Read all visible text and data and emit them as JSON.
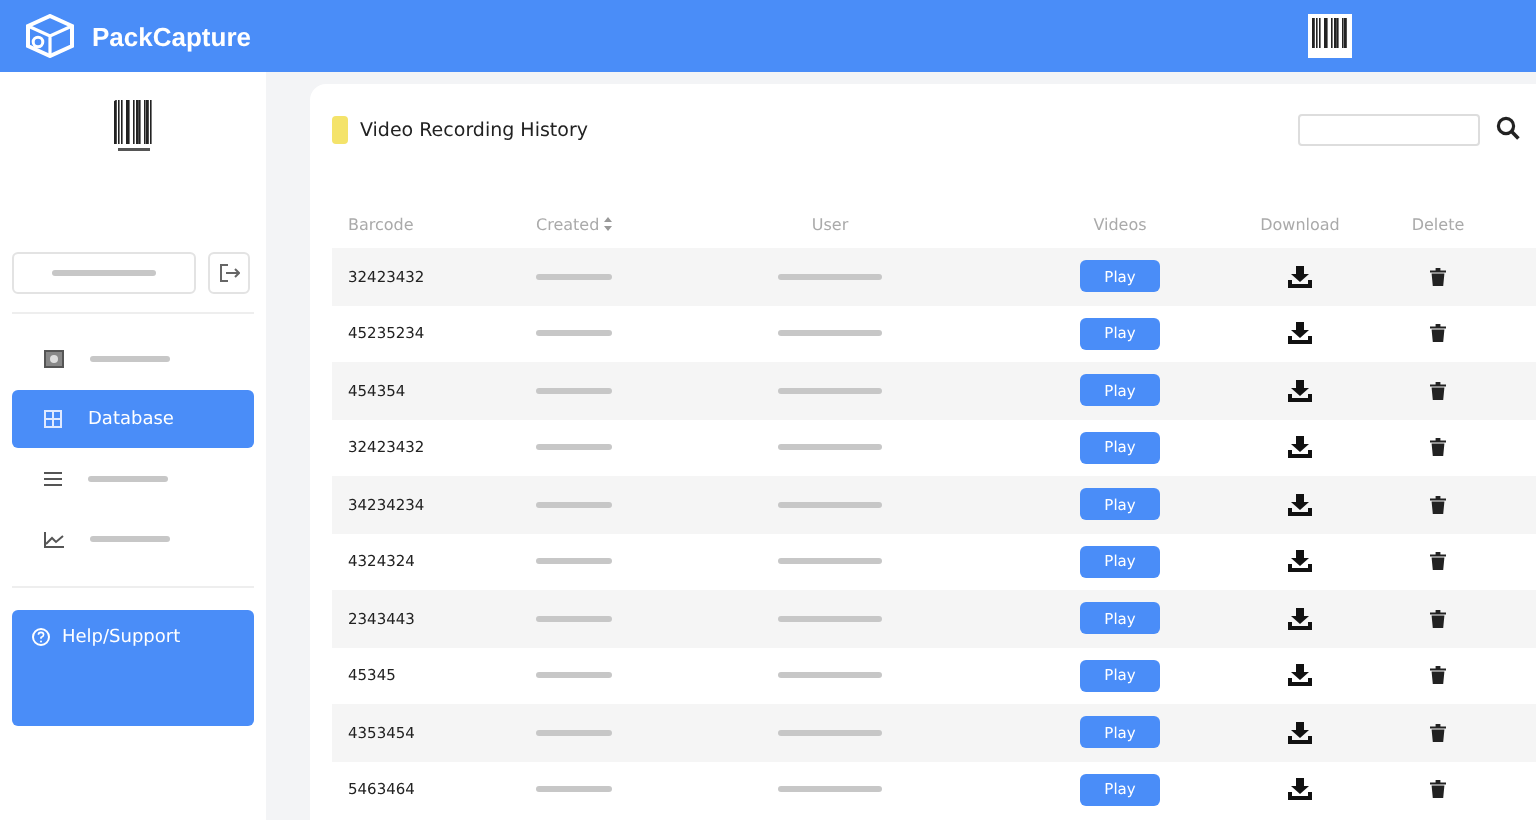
{
  "app": {
    "title": "PackCapture"
  },
  "sidebar": {
    "nav": [
      {
        "kind": "gallery",
        "selected": false
      },
      {
        "kind": "grid",
        "label": "Database",
        "selected": true
      },
      {
        "kind": "list",
        "selected": false
      },
      {
        "kind": "chart",
        "selected": false
      }
    ],
    "help": {
      "label": "Help/Support"
    }
  },
  "panel": {
    "title": "Video Recording History",
    "columns": [
      {
        "label": "Barcode",
        "sortable": false
      },
      {
        "label": "Created",
        "sortable": true
      },
      {
        "label": "User",
        "sortable": false
      },
      {
        "label": "Videos",
        "sortable": false
      },
      {
        "label": "Download",
        "sortable": false
      },
      {
        "label": "Delete",
        "sortable": false
      }
    ],
    "rows": [
      {
        "barcode": "32423432",
        "action": "Play"
      },
      {
        "barcode": "45235234",
        "action": "Play"
      },
      {
        "barcode": "454354",
        "action": "Play"
      },
      {
        "barcode": "32423432",
        "action": "Play"
      },
      {
        "barcode": "34234234",
        "action": "Play"
      },
      {
        "barcode": "4324324",
        "action": "Play"
      },
      {
        "barcode": "2343443",
        "action": "Play"
      },
      {
        "barcode": "45345",
        "action": "Play"
      },
      {
        "barcode": "4353454",
        "action": "Play"
      },
      {
        "barcode": "5463464",
        "action": "Play"
      }
    ]
  }
}
